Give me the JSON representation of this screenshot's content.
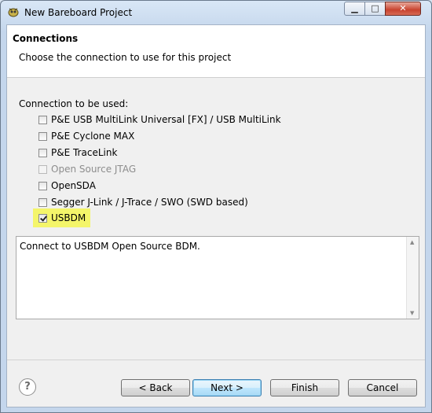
{
  "window": {
    "title": "New Bareboard Project"
  },
  "titlebar_buttons": {
    "minimize": "▁",
    "maximize": "□",
    "close": "✕"
  },
  "header": {
    "title": "Connections",
    "subtitle": "Choose the connection to use for this project"
  },
  "connections": {
    "label": "Connection to be used:",
    "options": [
      {
        "label": "P&E USB MultiLink Universal [FX] / USB MultiLink",
        "checked": false,
        "enabled": true
      },
      {
        "label": "P&E Cyclone MAX",
        "checked": false,
        "enabled": true
      },
      {
        "label": "P&E TraceLink",
        "checked": false,
        "enabled": true
      },
      {
        "label": "Open Source JTAG",
        "checked": false,
        "enabled": false
      },
      {
        "label": "OpenSDA",
        "checked": false,
        "enabled": true
      },
      {
        "label": "Segger J-Link / J-Trace / SWO (SWD based)",
        "checked": false,
        "enabled": true
      },
      {
        "label": "USBDM",
        "checked": true,
        "enabled": true
      }
    ]
  },
  "description": {
    "text": "Connect to USBDM Open Source BDM."
  },
  "footer": {
    "help": "?",
    "back": "< Back",
    "next": "Next >",
    "finish": "Finish",
    "cancel": "Cancel"
  },
  "colors": {
    "highlight": "#f4f56a",
    "default_button_border": "#3c7fb1"
  }
}
